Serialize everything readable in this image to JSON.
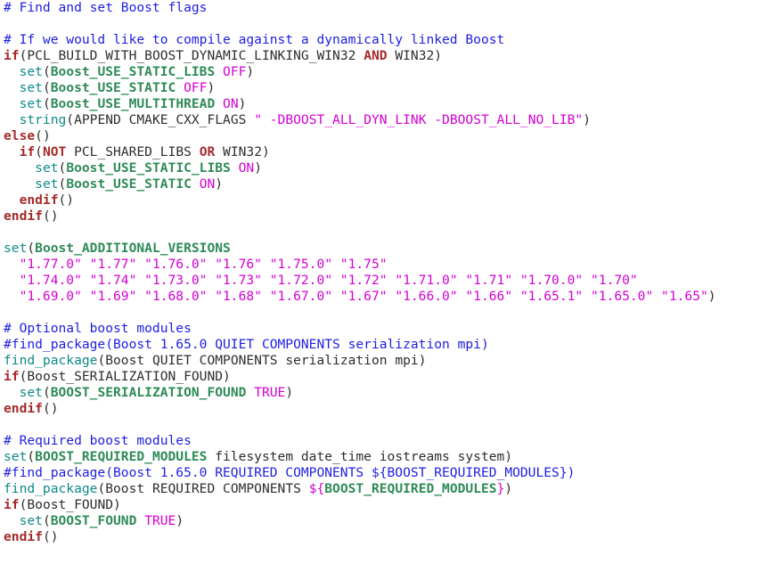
{
  "editor": {
    "lines": [
      [
        [
          "comment",
          "# Find and set Boost flags"
        ]
      ],
      [],
      [
        [
          "comment",
          "# If we would like to compile against a dynamically linked Boost"
        ]
      ],
      [
        [
          "control",
          "if"
        ],
        [
          "paren",
          "("
        ],
        [
          "plain",
          "PCL_BUILD_WITH_BOOST_DYNAMIC_LINKING_WIN32 "
        ],
        [
          "keyword",
          "AND"
        ],
        [
          "plain",
          " WIN32"
        ],
        [
          "paren",
          ")"
        ]
      ],
      [
        [
          "plain",
          "  "
        ],
        [
          "command",
          "set"
        ],
        [
          "paren",
          "("
        ],
        [
          "variable",
          "Boost_USE_STATIC_LIBS"
        ],
        [
          "plain",
          " "
        ],
        [
          "value",
          "OFF"
        ],
        [
          "paren",
          ")"
        ]
      ],
      [
        [
          "plain",
          "  "
        ],
        [
          "command",
          "set"
        ],
        [
          "paren",
          "("
        ],
        [
          "variable",
          "Boost_USE_STATIC"
        ],
        [
          "plain",
          " "
        ],
        [
          "value",
          "OFF"
        ],
        [
          "paren",
          ")"
        ]
      ],
      [
        [
          "plain",
          "  "
        ],
        [
          "command",
          "set"
        ],
        [
          "paren",
          "("
        ],
        [
          "variable",
          "Boost_USE_MULTITHREAD"
        ],
        [
          "plain",
          " "
        ],
        [
          "value",
          "ON"
        ],
        [
          "paren",
          ")"
        ]
      ],
      [
        [
          "plain",
          "  "
        ],
        [
          "command",
          "string"
        ],
        [
          "paren",
          "("
        ],
        [
          "plain",
          "APPEND CMAKE_CXX_FLAGS "
        ],
        [
          "string",
          "\" -DBOOST_ALL_DYN_LINK -DBOOST_ALL_NO_LIB\""
        ],
        [
          "paren",
          ")"
        ]
      ],
      [
        [
          "control",
          "else"
        ],
        [
          "paren",
          "()"
        ]
      ],
      [
        [
          "plain",
          "  "
        ],
        [
          "control",
          "if"
        ],
        [
          "paren",
          "("
        ],
        [
          "keyword",
          "NOT"
        ],
        [
          "plain",
          " PCL_SHARED_LIBS "
        ],
        [
          "keyword",
          "OR"
        ],
        [
          "plain",
          " WIN32"
        ],
        [
          "paren",
          ")"
        ]
      ],
      [
        [
          "plain",
          "    "
        ],
        [
          "command",
          "set"
        ],
        [
          "paren",
          "("
        ],
        [
          "variable",
          "Boost_USE_STATIC_LIBS"
        ],
        [
          "plain",
          " "
        ],
        [
          "value",
          "ON"
        ],
        [
          "paren",
          ")"
        ]
      ],
      [
        [
          "plain",
          "    "
        ],
        [
          "command",
          "set"
        ],
        [
          "paren",
          "("
        ],
        [
          "variable",
          "Boost_USE_STATIC"
        ],
        [
          "plain",
          " "
        ],
        [
          "value",
          "ON"
        ],
        [
          "paren",
          ")"
        ]
      ],
      [
        [
          "plain",
          "  "
        ],
        [
          "control",
          "endif"
        ],
        [
          "paren",
          "()"
        ]
      ],
      [
        [
          "control",
          "endif"
        ],
        [
          "paren",
          "()"
        ]
      ],
      [],
      [
        [
          "command",
          "set"
        ],
        [
          "paren",
          "("
        ],
        [
          "variable",
          "Boost_ADDITIONAL_VERSIONS"
        ]
      ],
      [
        [
          "plain",
          "  "
        ],
        [
          "string",
          "\"1.77.0\" \"1.77\" \"1.76.0\" \"1.76\" \"1.75.0\" \"1.75\""
        ]
      ],
      [
        [
          "plain",
          "  "
        ],
        [
          "string",
          "\"1.74.0\" \"1.74\" \"1.73.0\" \"1.73\" \"1.72.0\" \"1.72\" \"1.71.0\" \"1.71\" \"1.70.0\" \"1.70\""
        ]
      ],
      [
        [
          "plain",
          "  "
        ],
        [
          "string",
          "\"1.69.0\" \"1.69\" \"1.68.0\" \"1.68\" \"1.67.0\" \"1.67\" \"1.66.0\" \"1.66\" \"1.65.1\" \"1.65.0\" \"1.65\""
        ],
        [
          "paren",
          ")"
        ]
      ],
      [],
      [
        [
          "comment",
          "# Optional boost modules"
        ]
      ],
      [
        [
          "comment",
          "#find_package(Boost 1.65.0 QUIET COMPONENTS serialization mpi)"
        ]
      ],
      [
        [
          "command",
          "find_package"
        ],
        [
          "paren",
          "("
        ],
        [
          "plain",
          "Boost QUIET COMPONENTS serialization mpi"
        ],
        [
          "paren",
          ")"
        ]
      ],
      [
        [
          "control",
          "if"
        ],
        [
          "paren",
          "("
        ],
        [
          "plain",
          "Boost_SERIALIZATION_FOUND"
        ],
        [
          "paren",
          ")"
        ]
      ],
      [
        [
          "plain",
          "  "
        ],
        [
          "command",
          "set"
        ],
        [
          "paren",
          "("
        ],
        [
          "variable",
          "BOOST_SERIALIZATION_FOUND"
        ],
        [
          "plain",
          " "
        ],
        [
          "value",
          "TRUE"
        ],
        [
          "paren",
          ")"
        ]
      ],
      [
        [
          "control",
          "endif"
        ],
        [
          "paren",
          "()"
        ]
      ],
      [],
      [
        [
          "comment",
          "# Required boost modules"
        ]
      ],
      [
        [
          "command",
          "set"
        ],
        [
          "paren",
          "("
        ],
        [
          "variable",
          "BOOST_REQUIRED_MODULES"
        ],
        [
          "plain",
          " filesystem date_time iostreams system"
        ],
        [
          "paren",
          ")"
        ]
      ],
      [
        [
          "comment",
          "#find_package(Boost 1.65.0 REQUIRED COMPONENTS ${BOOST_REQUIRED_MODULES})"
        ]
      ],
      [
        [
          "command",
          "find_package"
        ],
        [
          "paren",
          "("
        ],
        [
          "plain",
          "Boost REQUIRED COMPONENTS "
        ],
        [
          "value",
          "${"
        ],
        [
          "variable",
          "BOOST_REQUIRED_MODULES"
        ],
        [
          "value",
          "}"
        ],
        [
          "paren",
          ")"
        ]
      ],
      [
        [
          "control",
          "if"
        ],
        [
          "paren",
          "("
        ],
        [
          "plain",
          "Boost_FOUND"
        ],
        [
          "paren",
          ")"
        ]
      ],
      [
        [
          "plain",
          "  "
        ],
        [
          "command",
          "set"
        ],
        [
          "paren",
          "("
        ],
        [
          "variable",
          "BOOST_FOUND"
        ],
        [
          "plain",
          " "
        ],
        [
          "value",
          "TRUE"
        ],
        [
          "paren",
          ")"
        ]
      ],
      [
        [
          "control",
          "endif"
        ],
        [
          "paren",
          "()"
        ]
      ]
    ]
  },
  "colors": {
    "background": "#ffffff",
    "comment": "#1f1fe0",
    "command": "#0e8a8a",
    "control": "#a52a2a",
    "variable": "#2e8b57",
    "value": "#d400d4",
    "plain": "#2e2e2e"
  }
}
